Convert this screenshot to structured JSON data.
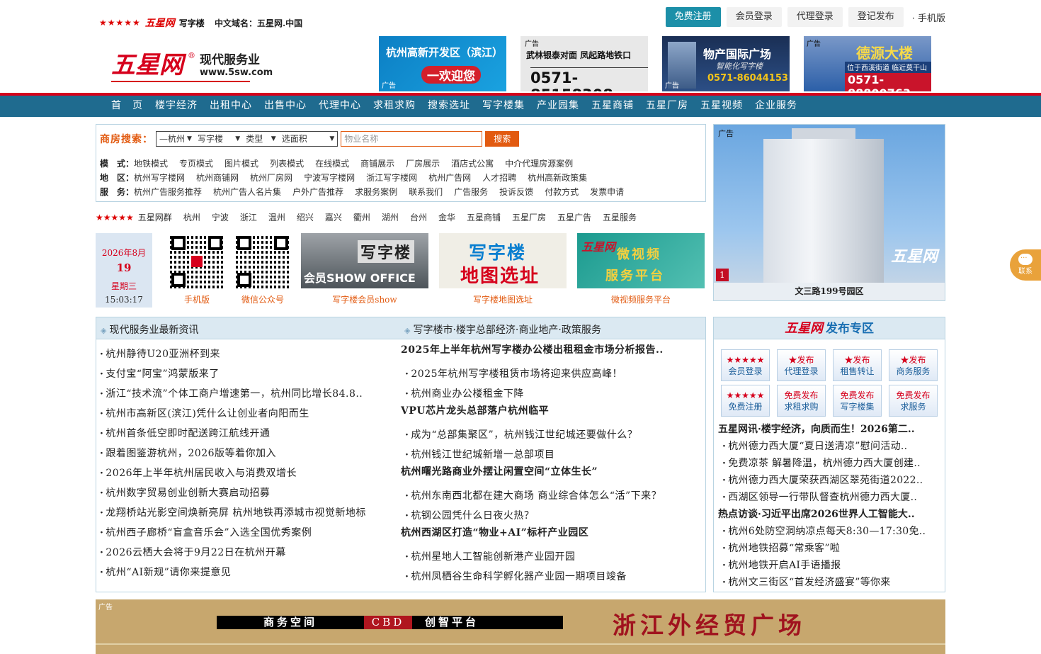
{
  "top": {
    "stars": "★★★★★",
    "brand_small": "五星网",
    "word_small": "写字楼",
    "domain_label": "中文域名：五星网.中国",
    "actions": [
      "免费注册",
      "会员登录",
      "代理登录",
      "登记发布"
    ],
    "mobile": "· 手机版"
  },
  "logo": {
    "brand": "五星网",
    "reg": "®",
    "tagline": "现代服务业",
    "url": "www.5sw.com"
  },
  "ads": {
    "tag": "广告",
    "ad1": {
      "title": "杭州高新开发区（滨江）",
      "sub": "一欢迎您"
    },
    "ad2": {
      "line1": "武林银泰对面  凤起路地铁口",
      "phone": "0571-85158308"
    },
    "ad3": {
      "title": "物产国际广场",
      "sub": "智能化写字楼",
      "phone": "0571-86044153"
    },
    "ad4": {
      "title": "德源大楼",
      "sub": "位于西溪街道 临近莫干山路",
      "phone": "0571-88800763"
    }
  },
  "nav": [
    "首　页",
    "楼宇经济",
    "出租中心",
    "出售中心",
    "代理中心",
    "求租求购",
    "搜索选址",
    "写字楼集",
    "产业园集",
    "五星商铺",
    "五星厂房",
    "五星视频",
    "企业服务"
  ],
  "search": {
    "label": "商房搜索：",
    "city": "—杭州",
    "category": "写字楼",
    "type": "类型",
    "area": "选面积",
    "placeholder": "物业名称",
    "button": "搜索"
  },
  "links": {
    "mode_label": "模　式：",
    "modes": [
      "地铁模式",
      "专页模式",
      "图片模式",
      "列表模式",
      "在线模式",
      "商铺展示",
      "厂房展示",
      "酒店式公寓",
      "中介代理房源案例"
    ],
    "area_label": "地　区：",
    "areas": [
      "杭州写字楼网",
      "杭州商铺网",
      "杭州厂房网",
      "宁波写字楼网",
      "浙江写字楼网",
      "杭州广告网",
      "人才招聘",
      "杭州高新政策集"
    ],
    "service_label": "服　务：",
    "services": [
      "杭州广告服务推荐",
      "杭州广告人名片集",
      "户外广告推荐",
      "求服务案例",
      "联系我们",
      "广告服务",
      "投诉反馈",
      "付款方式",
      "发票申请"
    ]
  },
  "cities": {
    "stars": "★★★★★",
    "items": [
      "五星网群",
      "杭州",
      "宁波",
      "浙江",
      "温州",
      "绍兴",
      "嘉兴",
      "衢州",
      "湖州",
      "台州",
      "金华",
      "五星商铺",
      "五星厂房",
      "五星广告",
      "五星服务"
    ]
  },
  "date": {
    "month": "2026年8月",
    "day": "19",
    "weekday": "星期三",
    "time": "15:03:17"
  },
  "tiles": {
    "qr1": "手机版",
    "qr2": "微信公众号",
    "t1_title": "写字楼",
    "t1_sub": "会员SHOW OFFICE",
    "t1_cap": "写字楼会员show",
    "t2_l1": "写字楼",
    "t2_l2": "地图选址",
    "t2_cap": "写字楼地图选址",
    "t3_brand": "五星网",
    "t3_l1": "微视频",
    "t3_l2": "服务平台",
    "t3_cap": "微视频服务平台"
  },
  "right_ad": {
    "tag": "广告",
    "num": "1",
    "sig": "五星网",
    "caption": "文三路199号园区"
  },
  "news": {
    "left_title": "现代服务业最新资讯",
    "right_title": "写字楼市·楼宇总部经济·商业地产·政策服务",
    "left": [
      "杭州静待U20亚洲杯到来",
      "支付宝“阿宝”鸿蒙版来了",
      "浙江“技术流”个体工商户增速第一，杭州同比增长84.8..",
      "杭州市高新区(滨江)凭什么让创业者向阳而生",
      "杭州首条低空即时配送跨江航线开通",
      "跟着图鉴游杭州，2026版等着你加入",
      "2026年上半年杭州居民收入与消费双增长",
      "杭州数字贸易创业创新大赛启动招募",
      "龙翔桥站光影空间焕新亮屏 杭州地铁再添城市视觉新地标",
      "杭州西子廊桥“盲盒音乐会”入选全国优秀案例",
      "2026云栖大会将于9月22日在杭州开幕",
      "杭州“AI新规”请你来提意见"
    ],
    "right": [
      {
        "head": "2025年上半年杭州写字楼办公楼出租租金市场分析报告..",
        "items": [
          "2025年杭州写字楼租赁市场将迎来供应高峰！",
          "杭州商业办公楼租金下降"
        ]
      },
      {
        "head": "VPU芯片龙头总部落户杭州临平",
        "items": [
          "成为“总部集聚区”，杭州钱江世纪城还要做什么？",
          "杭州钱江世纪城新增一总部项目"
        ]
      },
      {
        "head": "杭州曙光路商业外摆让闲置空间“立体生长”",
        "items": [
          "杭州东南西北都在建大商场 商业综合体怎么“活”下来？",
          "杭钢公园凭什么日夜火热？"
        ]
      },
      {
        "head": "杭州西湖区打造“物业+AI”标杆产业园区",
        "items": [
          "杭州星地人工智能创新港产业园开园",
          "杭州凤栖谷生命科学孵化器产业园一期项目竣备"
        ]
      }
    ]
  },
  "publish": {
    "brand": "五星网",
    "title": "发布专区",
    "buttons": [
      {
        "r": "★★★★★",
        "t": "会员登录"
      },
      {
        "r": "★发布",
        "t": "代理登录"
      },
      {
        "r": "★发布",
        "t": "租售转让"
      },
      {
        "r": "★发布",
        "t": "商务服务"
      },
      {
        "r": "★★★★★",
        "t": "免费注册"
      },
      {
        "r": "免费发布",
        "t": "求租求购"
      },
      {
        "r": "免费发布",
        "t": "写字楼集"
      },
      {
        "r": "免费发布",
        "t": "求服务"
      }
    ],
    "groups": [
      {
        "head": "五星网讯·楼宇经济，向质而生！2026第二..",
        "items": [
          "杭州德力西大厦“夏日送清凉”慰问活动..",
          "免费凉茶 解暑降温，杭州德力西大厦创建..",
          "杭州德力西大厦荣获西湖区翠苑街道2022..",
          "西湖区领导一行带队督查杭州德力西大厦.."
        ]
      },
      {
        "head": "热点访谈·习近平出席2026世界人工智能大..",
        "items": [
          "杭州6处防空洞纳凉点每天8:30—17:30免..",
          "杭州地铁招募“常乘客”啦",
          "杭州地铁开启AI手语播报",
          "杭州文三街区“首发经济盛宴”等你来"
        ]
      }
    ]
  },
  "bottom_ad": {
    "tag": "广告",
    "a": "商务空间",
    "b": "CBD",
    "c": "创智平台",
    "big": "浙江外经贸广场"
  },
  "chat": {
    "label": "联系"
  }
}
